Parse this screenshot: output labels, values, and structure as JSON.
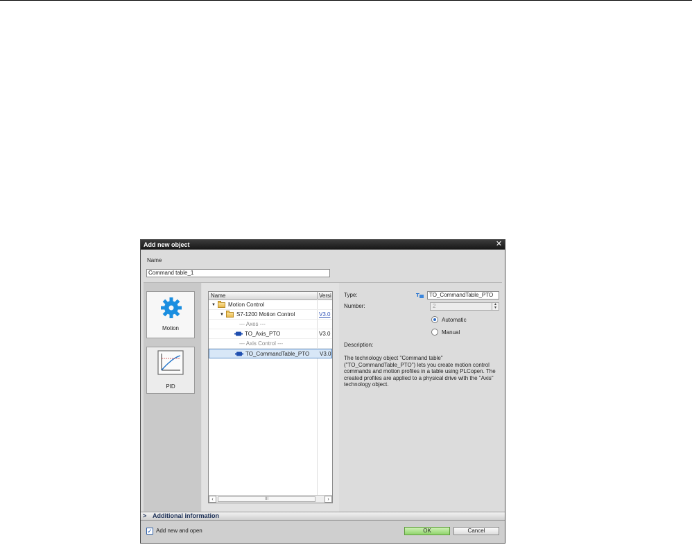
{
  "dialog": {
    "title": "Add new object",
    "name_label": "Name",
    "name_value": "Command table_1",
    "categories": [
      {
        "label": "Motion",
        "icon": "gear-icon"
      },
      {
        "label": "PID",
        "icon": "pid-chart-icon"
      }
    ],
    "tree": {
      "headers": {
        "name": "Name",
        "version": "Versi"
      },
      "rows": [
        {
          "text": "Motion Control",
          "version": ""
        },
        {
          "text": "S7-1200 Motion Control",
          "version": "V3.0"
        },
        {
          "text": "--- Axes ---",
          "version": ""
        },
        {
          "text": "TO_Axis_PTO",
          "version": "V3.0"
        },
        {
          "text": "--- Axis Control ---",
          "version": ""
        },
        {
          "text": "TO_CommandTable_PTO",
          "version": "V3.0"
        }
      ],
      "scroll_thumb": "III"
    },
    "details": {
      "type_label": "Type:",
      "type_value": "TO_CommandTable_PTO",
      "number_label": "Number:",
      "number_value": "2",
      "radio_automatic": "Automatic",
      "radio_manual": "Manual",
      "description_label": "Description:",
      "description": "The technology object \"Command table\" (\"TO_CommandTable_PTO\") lets you create motion control commands and motion profiles in a table using PLCopen. The created profiles are applied to a physical drive with the \"Axis\" technology object."
    },
    "additional_information": "Additional information",
    "add_new_and_open": "Add new and open",
    "ok": "OK",
    "cancel": "Cancel",
    "colors": {
      "ok_button": "#8fd46a",
      "selection": "#d8e7f7",
      "accent": "#2d6ac4"
    }
  }
}
